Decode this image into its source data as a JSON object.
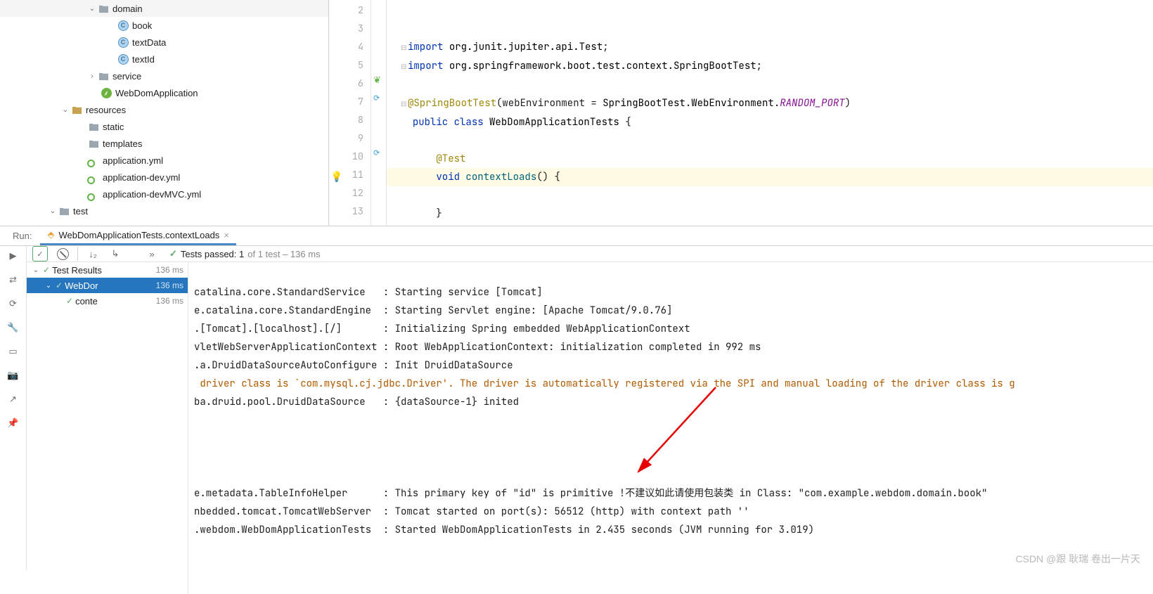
{
  "tree": {
    "domain": "domain",
    "book": "book",
    "textData": "textData",
    "textId": "textId",
    "service": "service",
    "app": "WebDomApplication",
    "resources": "resources",
    "static": "static",
    "templates": "templates",
    "yml1": "application.yml",
    "yml2": "application-dev.yml",
    "yml3": "application-devMVC.yml",
    "test": "test"
  },
  "gutter": {
    "l2": "2",
    "l3": "3",
    "l4": "4",
    "l5": "5",
    "l6": "6",
    "l7": "7",
    "l8": "8",
    "l9": "9",
    "l10": "10",
    "l11": "11",
    "l12": "12",
    "l13": "13"
  },
  "code": {
    "import": "import",
    "pkg_junit": "org.junit.jupiter.api.",
    "test_cls": "Test",
    "pkg_spring": "org.springframework.boot.test.context.",
    "sbt": "SpringBootTest",
    "ann_sbt": "@SpringBootTest",
    "we_param": "webEnvironment = ",
    "sbt2": "SpringBootTest",
    "we": "WebEnvironment",
    "rp": "RANDOM_PORT",
    "public": "public",
    "class": "class",
    "cname": "WebDomApplicationTests",
    "ann_test": "@Test",
    "void": "void",
    "mname": "contextLoads",
    "parens": "() {",
    "brace_open": " {",
    "brace_close": "}"
  },
  "run": {
    "label": "Run:",
    "tab_name": "WebDomApplicationTests.contextLoads",
    "passed_prefix": "Tests passed: 1",
    "passed_suffix": " of 1 test – 136 ms"
  },
  "testtree": {
    "r1": "Test Results",
    "r1ms": "136 ms",
    "r2": "WebDor",
    "r2ms": "136 ms",
    "r3": "conte",
    "r3ms": "136 ms"
  },
  "console": {
    "l1": "catalina.core.StandardService   : Starting service [Tomcat]",
    "l2": "e.catalina.core.StandardEngine  : Starting Servlet engine: [Apache Tomcat/9.0.76]",
    "l3": ".[Tomcat].[localhost].[/]       : Initializing Spring embedded WebApplicationContext",
    "l4": "vletWebServerApplicationContext : Root WebApplicationContext: initialization completed in 992 ms",
    "l5": ".a.DruidDataSourceAutoConfigure : Init DruidDataSource",
    "l6": " driver class is `com.mysql.cj.jdbc.Driver'. The driver is automatically registered via the SPI and manual loading of the driver class is g",
    "l7": "ba.druid.pool.DruidDataSource   : {dataSource-1} inited",
    "l8": "e.metadata.TableInfoHelper      : This primary key of \"id\" is primitive !不建议如此请使用包装类 in Class: \"com.example.webdom.domain.book\"",
    "l9": "nbedded.tomcat.TomcatWebServer  : Tomcat started on port(s): 56512 (http) with context path ''",
    "l10": ".webdom.WebDomApplicationTests  : Started WebDomApplicationTests in 2.435 seconds (JVM running for 3.019)"
  },
  "watermark": "CSDN @跟 耿瑞 卷出一片天"
}
